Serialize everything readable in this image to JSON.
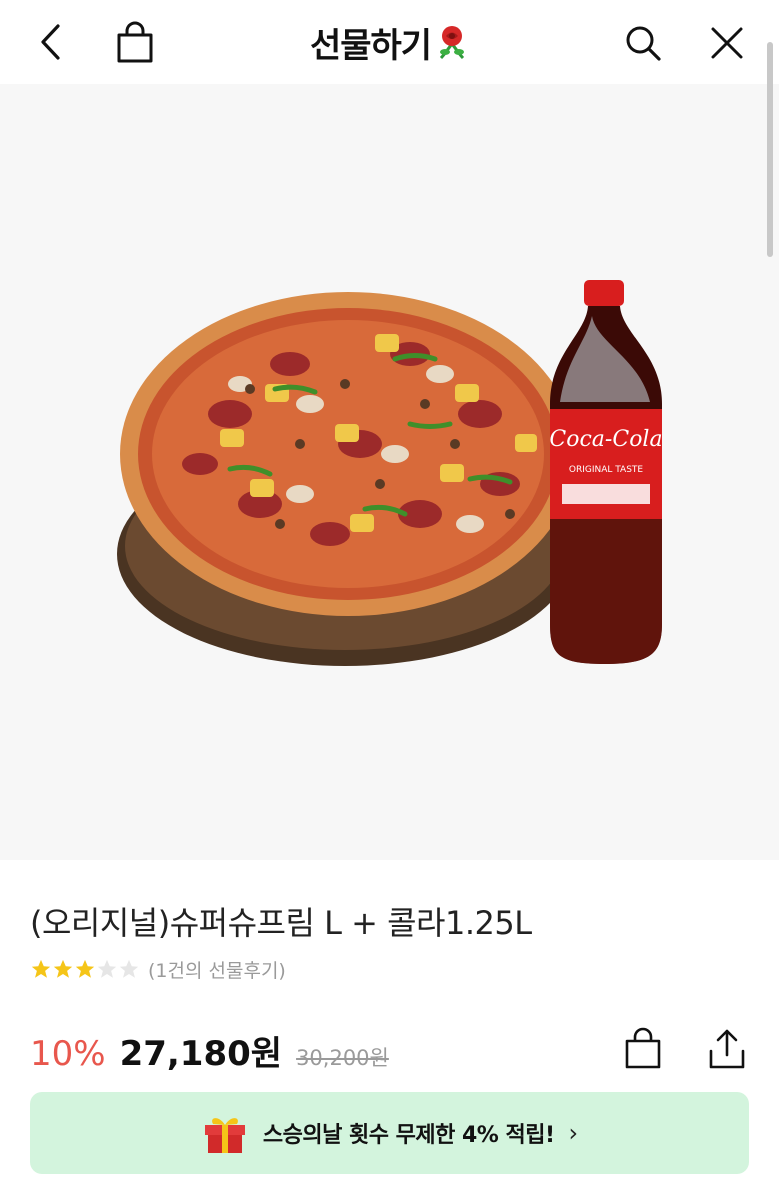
{
  "header": {
    "title": "선물하기",
    "back_icon": "chevron-left-icon",
    "bag_icon": "shopping-bag-icon",
    "search_icon": "search-icon",
    "close_icon": "close-icon",
    "title_emoji": "rose-icon"
  },
  "product": {
    "title": "(오리지널)슈퍼슈프림 L + 콜라1.25L",
    "rating_stars": 3,
    "rating_max": 5,
    "review_text": "(1건의 선물후기)",
    "discount": "10%",
    "price": "27,180원",
    "original_price": "30,200원",
    "image_bottle_label": "Coca-Cola",
    "image_bottle_sub": "ORIGINAL TASTE"
  },
  "promo": {
    "text": "스승의날 횟수 무제한 4% 적립!",
    "arrow": "›",
    "icon": "gift-icon"
  },
  "colors": {
    "discount": "#e8574d",
    "star": "#f5c518",
    "promo_bg": "#d3f4dd"
  }
}
